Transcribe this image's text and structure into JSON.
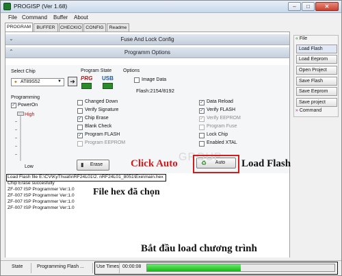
{
  "window": {
    "title": "PROGISP (Ver 1.68)"
  },
  "menu": [
    "File",
    "Command",
    "Buffer",
    "About"
  ],
  "tabs": [
    "PROGRAM",
    "BUFFER",
    "CHECKIO",
    "CONFIG",
    "Readme"
  ],
  "bars": {
    "fuse": "Fuse And Lock Config",
    "programm": "Programm Options"
  },
  "chip": {
    "label": "Select Chip",
    "value": "AT89S52",
    "go": "➔"
  },
  "program_state": {
    "label": "Program State",
    "prg": "PRG",
    "usb": "USB"
  },
  "options": {
    "label": "Options",
    "image_data": "Image Data",
    "flash_info": "Flash:2154/8192"
  },
  "programming": {
    "label": "Programming",
    "poweron": "PowerOn",
    "high": "High",
    "low": "Low"
  },
  "checks_mid": [
    {
      "label": "Changed Down",
      "checked": false,
      "dim": false
    },
    {
      "label": "Verify Signature",
      "checked": false,
      "dim": false
    },
    {
      "label": "Chip Erase",
      "checked": true,
      "dim": false
    },
    {
      "label": "Blank Check",
      "checked": false,
      "dim": false
    },
    {
      "label": "Program FLASH",
      "checked": true,
      "dim": false
    },
    {
      "label": "Program EEPROM",
      "checked": false,
      "dim": true
    }
  ],
  "checks_right": [
    {
      "label": "Data Reload",
      "checked": true,
      "dim": false
    },
    {
      "label": "Verify FLASH",
      "checked": true,
      "dim": false
    },
    {
      "label": "Verify EEPROM",
      "checked": true,
      "dim": true
    },
    {
      "label": "Program Fuse",
      "checked": false,
      "dim": true
    },
    {
      "label": "Lock Chip",
      "checked": false,
      "dim": false
    },
    {
      "label": "Enabled XTAL",
      "checked": false,
      "dim": false
    }
  ],
  "buttons": {
    "erase": "Erase",
    "auto": "Auto"
  },
  "log": [
    "Load Flash file E:\\CV\\KyThuat\\nRF24L01\\2. nRF24L01_8051\\Exe\\main.hex",
    "Chip Erase succesfully",
    "ZF-007 ISP Programmer Ver:1.0",
    "ZF-007 ISP Programmer Ver:1.0",
    "ZF-007 ISP Programmer Ver:1.0",
    "ZF-007 ISP Programmer Ver:1.0"
  ],
  "sidebar": {
    "file_head": "File",
    "items": [
      "Load Flash",
      "Load Eeprom",
      "Open Project",
      "Save Flash",
      "Save Eeprom",
      "Save project"
    ],
    "command_head": "Command"
  },
  "status": {
    "state_label": "State",
    "state_value": "Programming Flash ...",
    "use_times_label": "Use Times",
    "time": "00:00:08",
    "progress": 0.5
  },
  "annotations": {
    "click_auto": "Click Auto",
    "load_flash": "Load Flash",
    "file_hex": "File hex đã chọn",
    "bat_dau": "Bắt đầu load chương trình"
  },
  "watermark": "GROUP",
  "colors": {
    "annotation_red": "#d51a1a",
    "progress_green": "#16b916",
    "title_bar": "#c9d8ea"
  }
}
